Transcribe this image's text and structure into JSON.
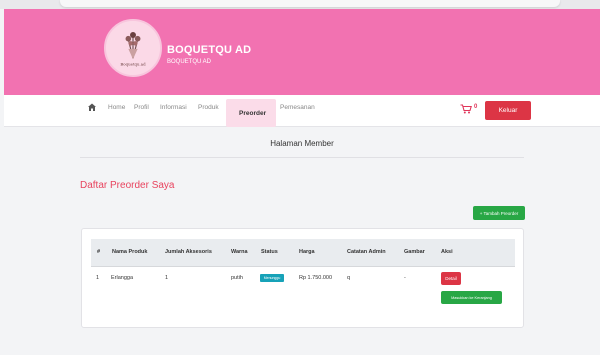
{
  "brand": {
    "title": "BOQUETQU AD",
    "subtitle": "BOQUETQU AD",
    "logo_text": "Boquetqu.ad"
  },
  "nav": {
    "icon": "home-icon",
    "items": [
      "Home",
      "Profil",
      "Informasi",
      "Produk",
      "Preorder",
      "Pemesanan"
    ],
    "active": "Preorder",
    "cart_count": "0",
    "logout_label": "Keluar"
  },
  "page": {
    "heading": "Halaman Member",
    "section_title": "Daftar Preorder Saya",
    "add_button": "+ Tambah Preorder"
  },
  "table": {
    "headers": [
      "#",
      "Nama Produk",
      "Jumlah Aksesoris",
      "Warna",
      "Status",
      "Harga",
      "Catatan Admin",
      "Gambar",
      "Aksi"
    ],
    "rows": [
      {
        "no": "1",
        "nama_produk": "Erlangga",
        "jumlah_aksesoris": "1",
        "warna": "putih",
        "status": "Menunggu",
        "harga": "Rp 1.750.000",
        "catatan_admin": "q",
        "gambar": "-",
        "aksi_detail": "Detail",
        "aksi_keranjang": "Masukkan ke Keranjang"
      }
    ]
  },
  "colors": {
    "header_pink": "#f272b1",
    "accent_red": "#dc3545",
    "success_green": "#28a745",
    "title_red": "#e8435e",
    "badge_info": "#17a2b8"
  }
}
